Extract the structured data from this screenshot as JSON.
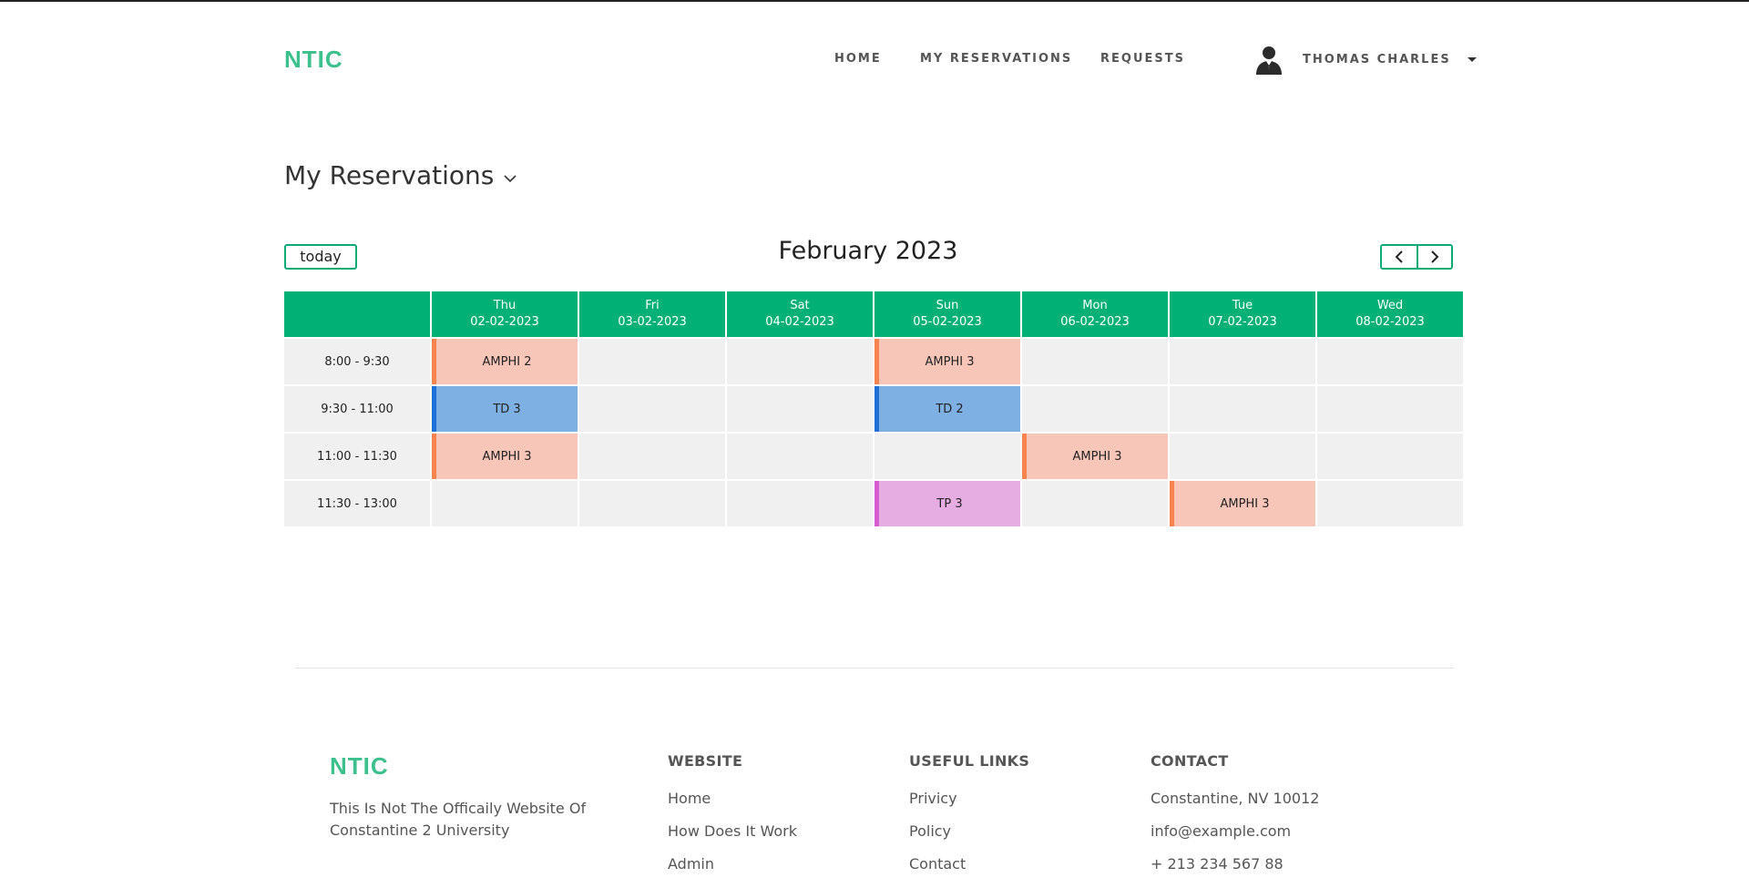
{
  "brand": {
    "logo": "NTIC",
    "color": "#3cc08e"
  },
  "nav": {
    "items": [
      "HOME",
      "MY RESERVATIONS",
      "REQUESTS"
    ],
    "user": {
      "name": "THOMAS CHARLES",
      "avatar_icon": "user-silhouette-icon"
    }
  },
  "page": {
    "title": "My Reservations"
  },
  "calendar": {
    "today_label": "today",
    "title": "February 2023",
    "prev_icon": "chevron-left-icon",
    "next_icon": "chevron-right-icon",
    "header_color": "#00b074",
    "days": [
      {
        "name": "Thu",
        "date": "02-02-2023"
      },
      {
        "name": "Fri",
        "date": "03-02-2023"
      },
      {
        "name": "Sat",
        "date": "04-02-2023"
      },
      {
        "name": "Sun",
        "date": "05-02-2023"
      },
      {
        "name": "Mon",
        "date": "06-02-2023"
      },
      {
        "name": "Tue",
        "date": "07-02-2023"
      },
      {
        "name": "Wed",
        "date": "08-02-2023"
      }
    ],
    "slots": [
      "8:00 - 9:30",
      "9:30 - 11:00",
      "11:00 - 11:30",
      "11:30 - 13:00"
    ],
    "events": [
      {
        "day": 0,
        "slot": 0,
        "label": "AMPHI 2",
        "kind": "amphi"
      },
      {
        "day": 0,
        "slot": 1,
        "label": "TD 3",
        "kind": "td"
      },
      {
        "day": 0,
        "slot": 2,
        "label": "AMPHI 3",
        "kind": "amphi"
      },
      {
        "day": 3,
        "slot": 0,
        "label": "AMPHI 3",
        "kind": "amphi"
      },
      {
        "day": 3,
        "slot": 1,
        "label": "TD 2",
        "kind": "td"
      },
      {
        "day": 3,
        "slot": 3,
        "label": "TP 3",
        "kind": "tp"
      },
      {
        "day": 4,
        "slot": 2,
        "label": "AMPHI 3",
        "kind": "amphi"
      },
      {
        "day": 5,
        "slot": 3,
        "label": "AMPHI 3",
        "kind": "amphi"
      }
    ]
  },
  "footer": {
    "logo": "NTIC",
    "description": "This Is Not The Officaily Website Of Constantine 2 University",
    "columns": [
      {
        "title": "WEBSITE",
        "links": [
          "Home",
          "How Does It Work",
          "Admin"
        ]
      },
      {
        "title": "USEFUL LINKS",
        "links": [
          "Privicy",
          "Policy",
          "Contact"
        ]
      },
      {
        "title": "CONTACT",
        "links": [
          "Constantine, NV 10012",
          "info@example.com",
          "+ 213 234 567 88"
        ]
      }
    ]
  }
}
